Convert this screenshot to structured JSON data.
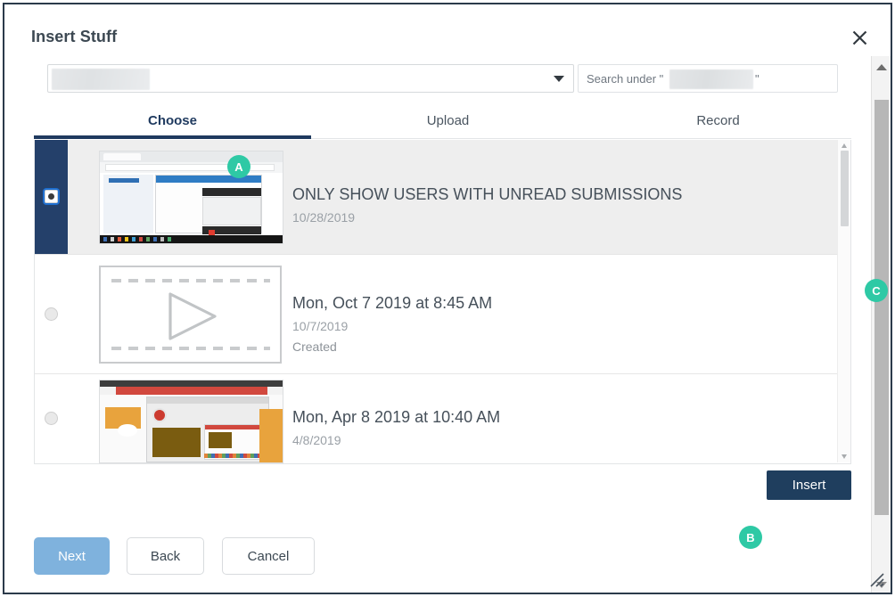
{
  "dialog": {
    "title": "Insert Stuff",
    "close_icon": "close-icon"
  },
  "filter": {
    "folder_select_value": "",
    "folder_caret_icon": "chevron-down-icon",
    "search_placeholder_prefix": "Search under \"",
    "search_placeholder_suffix": "\"",
    "search_value": ""
  },
  "tabs": [
    {
      "label": "Choose",
      "active": true
    },
    {
      "label": "Upload",
      "active": false
    },
    {
      "label": "Record",
      "active": false
    }
  ],
  "markers": [
    {
      "id": "A",
      "label": "A",
      "color": "#2ec9a5"
    },
    {
      "id": "B",
      "label": "B",
      "color": "#2ec9a5"
    },
    {
      "id": "C",
      "label": "C",
      "color": "#2ec9a5"
    }
  ],
  "items": [
    {
      "title": "ONLY SHOW USERS WITH UNREAD SUBMISSIONS",
      "date": "10/28/2019",
      "status": "",
      "selected": true,
      "thumbnail": "browser-screenshot-thumbnail"
    },
    {
      "title": "Mon, Oct 7 2019 at 8:45 AM",
      "date": "10/7/2019",
      "status": "Created",
      "selected": false,
      "thumbnail": "video-placeholder-thumbnail"
    },
    {
      "title": "Mon, Apr 8 2019 at 10:40 AM",
      "date": "4/8/2019",
      "status": "",
      "selected": false,
      "thumbnail": "presentation-screenshot-thumbnail"
    }
  ],
  "actions": {
    "insert_label": "Insert",
    "next_label": "Next",
    "back_label": "Back",
    "cancel_label": "Cancel"
  },
  "colors": {
    "accent_navy": "#1f3e5e",
    "marker_teal": "#2ec9a5",
    "next_blue": "#7fb2dd",
    "selected_row_bg": "#eeeeee",
    "selected_rail": "#24406a"
  }
}
